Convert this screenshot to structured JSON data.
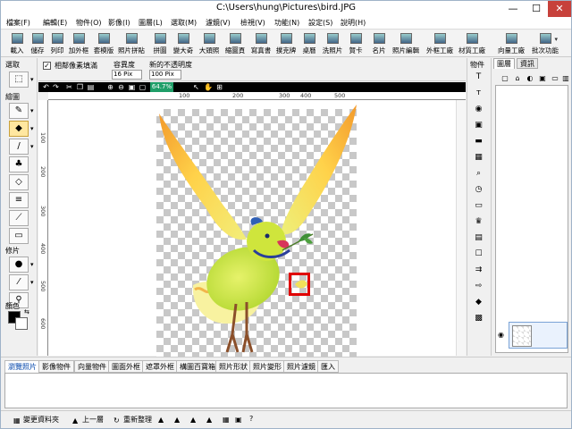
{
  "window": {
    "title": "C:\\Users\\hung\\Pictures\\bird.JPG",
    "minimize_glyph": "—",
    "maximize_glyph": "☐",
    "close_glyph": "✕"
  },
  "menu": [
    "檔案(F)",
    "編輯(E)",
    "物件(O)",
    "影像(I)",
    "圖層(L)",
    "選取(M)",
    "濾鏡(V)",
    "檢視(V)",
    "功能(N)",
    "設定(S)",
    "說明(H)"
  ],
  "toolbar": [
    {
      "label": "載入",
      "icon": "open-folder-icon"
    },
    {
      "label": "儲存",
      "icon": "save-disk-icon"
    },
    {
      "label": "列印",
      "icon": "printer-icon"
    },
    {
      "label": "加外框",
      "icon": "frame-icon"
    },
    {
      "label": "套模版",
      "icon": "template-icon"
    },
    {
      "label": "照片拼貼",
      "icon": "collage-icon"
    },
    {
      "label": "拼圖",
      "icon": "puzzle-icon"
    },
    {
      "label": "變大奇",
      "icon": "caricature-icon"
    },
    {
      "label": "大頭照",
      "icon": "id-photo-icon"
    },
    {
      "label": "縮圖頁",
      "icon": "thumbnail-page-icon"
    },
    {
      "label": "寫真書",
      "icon": "photobook-icon"
    },
    {
      "label": "撲克牌",
      "icon": "poker-card-icon"
    },
    {
      "label": "桌曆",
      "icon": "desk-calendar-icon"
    },
    {
      "label": "洗照片",
      "icon": "photo-print-icon"
    },
    {
      "label": "賀卡",
      "icon": "greeting-card-icon"
    },
    {
      "label": "名片",
      "icon": "business-card-icon"
    },
    {
      "label": "照片編輯",
      "icon": "photo-edit-icon"
    },
    {
      "label": "外框工廠",
      "icon": "frame-factory-icon"
    },
    {
      "label": "材質工廠",
      "icon": "texture-factory-icon"
    },
    {
      "label": "向量工廠",
      "icon": "vector-factory-icon"
    },
    {
      "label": "批次功能",
      "icon": "batch-icon"
    }
  ],
  "left_panel": {
    "select_label": "選取",
    "draw_label": "繪圖",
    "retouch_label": "修片",
    "color_label": "顏色"
  },
  "options": {
    "checkbox_label": "相鄰像素填滿",
    "checkbox_mark": "✓",
    "tolerance_label": "容異度",
    "tolerance_value": "16",
    "tolerance_unit": "Pix",
    "opacity_label": "新的不透明度",
    "opacity_value": "100",
    "opacity_unit": "Pix"
  },
  "canvas": {
    "zoom": "64.7%",
    "ruler_h": [
      "100",
      "200",
      "300",
      "400",
      "500"
    ],
    "ruler_v": [
      "100",
      "200",
      "300",
      "400",
      "500",
      "600"
    ]
  },
  "right_panel": {
    "objects_label": "物件",
    "tab_layers": "圖層",
    "tab_info": "資訊"
  },
  "bottom_tabs": [
    "瀏覽照片",
    "影像物件",
    "向量物件",
    "圖面外框",
    "遮罩外框",
    "構圖百寶箱",
    "照片形狀",
    "照片變形",
    "照片濾鏡",
    "匯入"
  ],
  "status": {
    "change_folder": "變更資料夾",
    "up_level": "上一層",
    "refresh": "重新整理",
    "help": "?"
  },
  "colors": {
    "accent_red": "#e00000",
    "zoom_bg": "#1f9e68",
    "close_btn": "#c7413b"
  }
}
